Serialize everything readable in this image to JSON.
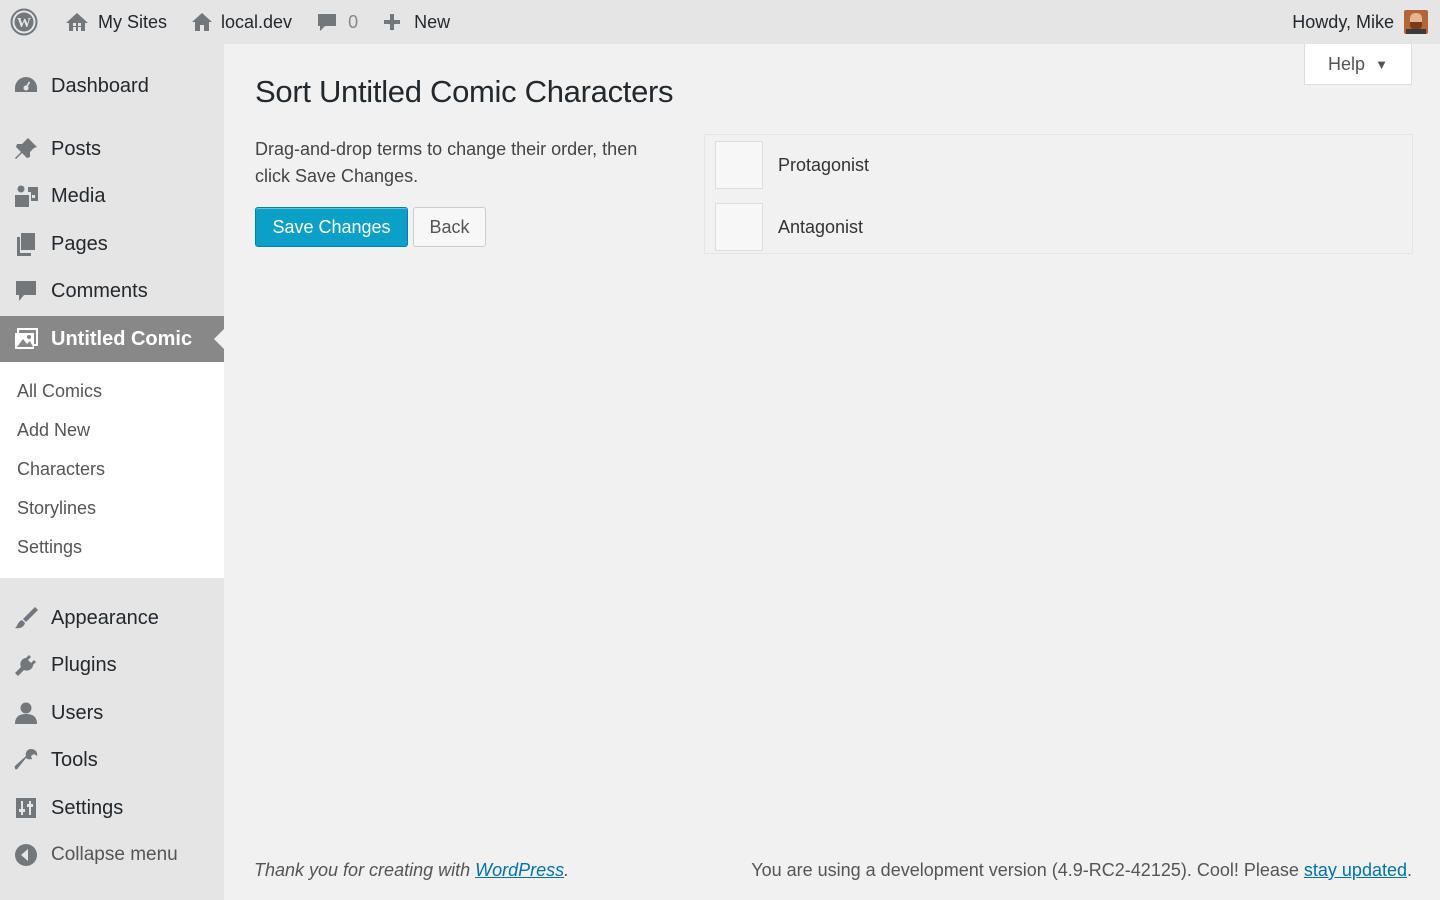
{
  "adminbar": {
    "my_sites": "My Sites",
    "site_name": "local.dev",
    "comments_count": "0",
    "new_label": "New",
    "howdy": "Howdy, Mike"
  },
  "sidebar": {
    "items": [
      {
        "label": "Dashboard",
        "icon": "dashboard-icon"
      },
      {
        "label": "Posts",
        "icon": "pushpin-icon"
      },
      {
        "label": "Media",
        "icon": "media-icon"
      },
      {
        "label": "Pages",
        "icon": "pages-icon"
      },
      {
        "label": "Comments",
        "icon": "comment-icon"
      },
      {
        "label": "Untitled Comic",
        "icon": "comic-icon",
        "current": true
      },
      {
        "label": "Appearance",
        "icon": "paintbrush-icon"
      },
      {
        "label": "Plugins",
        "icon": "plugin-icon"
      },
      {
        "label": "Users",
        "icon": "users-icon"
      },
      {
        "label": "Tools",
        "icon": "wrench-icon"
      },
      {
        "label": "Settings",
        "icon": "settings-icon"
      }
    ],
    "submenu": [
      "All Comics",
      "Add New",
      "Characters",
      "Storylines",
      "Settings"
    ],
    "collapse": "Collapse menu"
  },
  "help": {
    "label": "Help"
  },
  "page": {
    "title": "Sort Untitled Comic Characters",
    "instructions": "Drag-and-drop terms to change their order, then click Save Changes.",
    "save_label": "Save Changes",
    "back_label": "Back",
    "terms": [
      "Protagonist",
      "Antagonist"
    ]
  },
  "footer": {
    "thanks_prefix": "Thank you for creating with ",
    "wordpress_link": "WordPress",
    "thanks_suffix": ".",
    "version_prefix": "You are using a development version (4.9-RC2-42125). Cool! Please ",
    "update_link": "stay updated",
    "version_suffix": "."
  },
  "colors": {
    "primary_button": "#0aa0c7",
    "current_menu": "#888888",
    "link": "#0073aa"
  }
}
